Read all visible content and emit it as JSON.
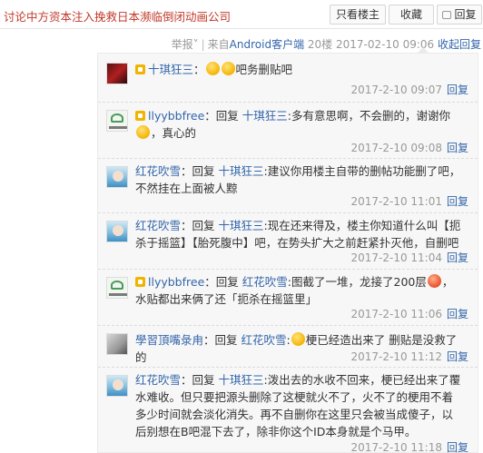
{
  "header": {
    "title": "讨论中方资本注入挽救日本濒临倒闭动画公司",
    "only_owner": "只看楼主",
    "favorite": "收藏",
    "reply": "回复"
  },
  "meta": {
    "report": "举报˅",
    "sep": "|",
    "from_prefix": "来自",
    "from_client": "Android客户端",
    "floor": "20楼",
    "time": "2017-02-10 09:06",
    "collapse": "收起回复"
  },
  "comments": [
    {
      "user": "十琪狂三",
      "text": "吧务删贴吧",
      "time": "2017-2-10 09:07",
      "reply_label": "回复",
      "avatar": "red-character-avatar"
    },
    {
      "user": "llyybbfree",
      "reply_word": "回复",
      "target": "十琪狂三",
      "text1": ":多有意思啊，不会删的，谢谢你",
      "text2": "，真心的",
      "time": "2017-2-10 09:08",
      "reply_label": "回复",
      "avatar": "logo-avatar"
    },
    {
      "user": "红花吹雪",
      "reply_word": "回复",
      "target": "十琪狂三",
      "text": ":建议你用楼主自带的删帖功能删了吧，不然挂在上面被人黥",
      "time": "2017-2-10 11:01",
      "reply_label": "回复",
      "avatar": "blue-character-avatar"
    },
    {
      "user": "红花吹雪",
      "reply_word": "回复",
      "target": "十琪狂三",
      "text": ":现在还来得及，楼主你知道什么叫【扼杀于摇篮】【胎死腹中】吧，在势头扩大之前赶紧扑灭他，自删吧",
      "time": "2017-2-10 11:04",
      "reply_label": "回复",
      "avatar": "blue-character-avatar"
    },
    {
      "user": "llyybbfree",
      "reply_word": "回复",
      "target": "红花吹雪",
      "text1": ":图截了一堆，龙接了200层",
      "text2": "，水贴都出来俩了还「扼杀在摇篮里」",
      "time": "2017-2-10 11:06",
      "reply_label": "回复",
      "avatar": "logo-avatar"
    },
    {
      "user": "學習頂嘴彔甪",
      "reply_word": "回复",
      "target": "红花吹雪",
      "text1": ":",
      "text2": "梗已经造出来了 删贴是没救了的",
      "time": "2017-2-10 11:12",
      "reply_label": "回复",
      "avatar": "gray-avatar"
    },
    {
      "user": "红花吹雪",
      "reply_word": "回复",
      "target": "十琪狂三",
      "text": ":泼出去的水收不回来，梗已经出来了覆水难收。但只要把源头删除了这梗就火不了，火不了的梗用不着多少时间就会淡化消失。再不自删你在这里只会被当成傻子，以后别想在B吧混下去了，除非你这个ID本身就是个马甲。",
      "time": "2017-2-10 11:18",
      "reply_label": "回复",
      "avatar": "blue-character-avatar"
    }
  ]
}
